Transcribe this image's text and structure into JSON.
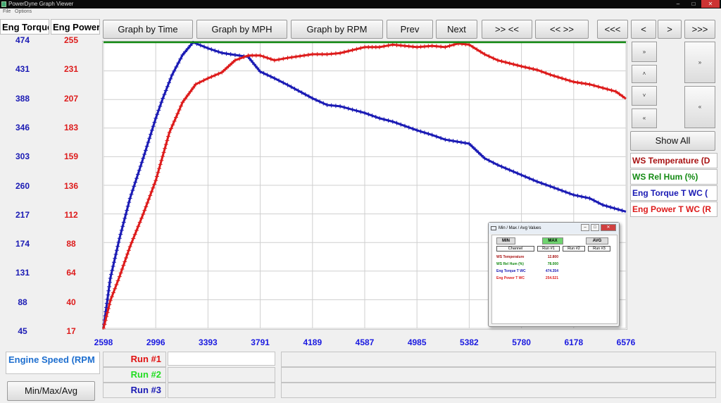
{
  "window": {
    "title": "PowerDyne Graph Viewer",
    "controls": [
      "–",
      "□",
      "✕"
    ]
  },
  "menu": [
    "File",
    "Options"
  ],
  "axes": {
    "left1": {
      "label": "Eng Torque",
      "color": "#1a1ab4",
      "ticks": [
        "474",
        "431",
        "388",
        "346",
        "303",
        "260",
        "217",
        "174",
        "131",
        "88",
        "45"
      ]
    },
    "left2": {
      "label": "Eng Power",
      "color": "#dd1b1b",
      "ticks": [
        "255",
        "231",
        "207",
        "183",
        "159",
        "136",
        "112",
        "88",
        "64",
        "40",
        "17"
      ]
    },
    "x": {
      "ticks": [
        "2598",
        "2996",
        "3393",
        "3791",
        "4189",
        "4587",
        "4985",
        "5382",
        "5780",
        "6178",
        "6576"
      ]
    }
  },
  "toolbar": {
    "buttons": [
      "Graph by Time",
      "Graph by MPH",
      "Graph by RPM",
      "Prev",
      "Next",
      ">> <<",
      "<< >>",
      "<<<",
      "<",
      ">",
      ">>>"
    ]
  },
  "side": {
    "scroll_labels": [
      "»",
      "˄",
      "˅",
      "«",
      "»",
      "«"
    ],
    "show_all": "Show All",
    "channels": [
      {
        "label": "WS Temperature (D",
        "color": "#a81212"
      },
      {
        "label": "WS Rel Hum (%)",
        "color": "#138a13"
      },
      {
        "label": "Eng Torque T WC (",
        "color": "#1a1ab4"
      },
      {
        "label": "Eng Power T WC (R",
        "color": "#dd1b1b"
      }
    ]
  },
  "bottom": {
    "xaxis_channel": "Engine Speed (RPM",
    "runs": [
      {
        "label": "Run #1",
        "color": "#e01010"
      },
      {
        "label": "Run #2",
        "color": "#22dd22"
      },
      {
        "label": "Run #3",
        "color": "#1a1ab4"
      }
    ],
    "minmax_button": "Min/Max/Avg"
  },
  "dialog": {
    "title": "Min / Max / Avg Values",
    "tabs": [
      {
        "label": "MIN",
        "active": false
      },
      {
        "label": "MAX",
        "active": true
      },
      {
        "label": "AVG",
        "active": false
      }
    ],
    "headers": [
      "Channel",
      "Run #1",
      "Run #2",
      "Run #3"
    ],
    "rows": [
      {
        "name": "WS Temperature",
        "value": "12.800",
        "color": "#a81212"
      },
      {
        "name": "WS Rel Hum (%)",
        "value": "78.000",
        "color": "#138a13"
      },
      {
        "name": "Eng Torque T WC",
        "value": "474.354",
        "color": "#1a1ab4"
      },
      {
        "name": "Eng Power T WC",
        "value": "254.521",
        "color": "#dd1b1b"
      }
    ]
  },
  "chart_data": {
    "type": "line",
    "x_axis": {
      "label": "Engine Speed (RPM)",
      "range": [
        2598,
        6576
      ]
    },
    "y_axes": [
      {
        "label": "Eng Torque",
        "range": [
          45,
          474
        ]
      },
      {
        "label": "Eng Power",
        "range": [
          17,
          255
        ]
      }
    ],
    "grid": true,
    "series": [
      {
        "name": "Eng Torque T WC",
        "axis": "Eng Torque",
        "color": "#1a1ab4",
        "marker": "plus",
        "points": [
          [
            2598,
            45
          ],
          [
            2650,
            120
          ],
          [
            2720,
            180
          ],
          [
            2800,
            240
          ],
          [
            2900,
            300
          ],
          [
            2996,
            360
          ],
          [
            3050,
            390
          ],
          [
            3120,
            425
          ],
          [
            3200,
            455
          ],
          [
            3280,
            474
          ],
          [
            3393,
            465
          ],
          [
            3500,
            458
          ],
          [
            3600,
            455
          ],
          [
            3700,
            452
          ],
          [
            3791,
            430
          ],
          [
            3900,
            420
          ],
          [
            4000,
            410
          ],
          [
            4189,
            390
          ],
          [
            4300,
            380
          ],
          [
            4400,
            378
          ],
          [
            4587,
            368
          ],
          [
            4700,
            360
          ],
          [
            4800,
            355
          ],
          [
            4985,
            342
          ],
          [
            5100,
            335
          ],
          [
            5200,
            328
          ],
          [
            5382,
            322
          ],
          [
            5500,
            300
          ],
          [
            5600,
            290
          ],
          [
            5780,
            275
          ],
          [
            5900,
            265
          ],
          [
            6000,
            258
          ],
          [
            6178,
            245
          ],
          [
            6300,
            240
          ],
          [
            6400,
            230
          ],
          [
            6576,
            220
          ]
        ]
      },
      {
        "name": "Eng Power T WC",
        "axis": "Eng Power",
        "color": "#dd1b1b",
        "marker": "plus",
        "points": [
          [
            2598,
            17
          ],
          [
            2650,
            40
          ],
          [
            2720,
            60
          ],
          [
            2800,
            85
          ],
          [
            2900,
            112
          ],
          [
            2996,
            140
          ],
          [
            3100,
            180
          ],
          [
            3200,
            205
          ],
          [
            3300,
            220
          ],
          [
            3393,
            225
          ],
          [
            3500,
            230
          ],
          [
            3600,
            240
          ],
          [
            3700,
            244
          ],
          [
            3791,
            244
          ],
          [
            3900,
            240
          ],
          [
            4000,
            242
          ],
          [
            4189,
            245
          ],
          [
            4300,
            245
          ],
          [
            4400,
            246
          ],
          [
            4587,
            251
          ],
          [
            4700,
            251
          ],
          [
            4800,
            253
          ],
          [
            4985,
            251
          ],
          [
            5100,
            252
          ],
          [
            5200,
            251
          ],
          [
            5300,
            254
          ],
          [
            5382,
            253
          ],
          [
            5500,
            245
          ],
          [
            5600,
            240
          ],
          [
            5780,
            235
          ],
          [
            5900,
            232
          ],
          [
            6000,
            228
          ],
          [
            6178,
            222
          ],
          [
            6300,
            220
          ],
          [
            6400,
            217
          ],
          [
            6500,
            214
          ],
          [
            6576,
            208
          ]
        ]
      },
      {
        "name": "WS Rel Hum (%)",
        "axis": "Eng Power",
        "color": "#138a13",
        "marker": "none",
        "points": [
          [
            2598,
            255
          ],
          [
            6576,
            255
          ]
        ]
      }
    ]
  }
}
